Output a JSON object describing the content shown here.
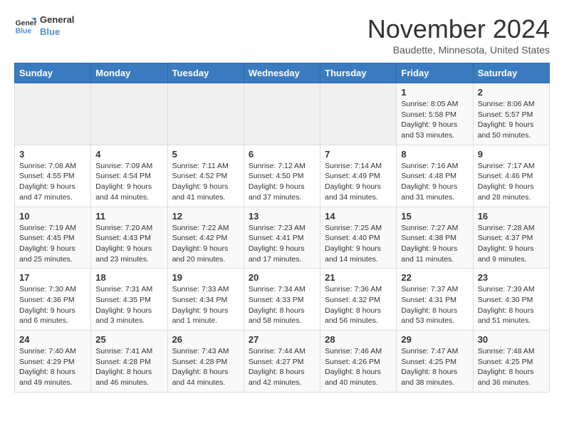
{
  "logo": {
    "line1": "General",
    "line2": "Blue"
  },
  "title": "November 2024",
  "location": "Baudette, Minnesota, United States",
  "days_of_week": [
    "Sunday",
    "Monday",
    "Tuesday",
    "Wednesday",
    "Thursday",
    "Friday",
    "Saturday"
  ],
  "weeks": [
    [
      {
        "day": "",
        "info": ""
      },
      {
        "day": "",
        "info": ""
      },
      {
        "day": "",
        "info": ""
      },
      {
        "day": "",
        "info": ""
      },
      {
        "day": "",
        "info": ""
      },
      {
        "day": "1",
        "info": "Sunrise: 8:05 AM\nSunset: 5:58 PM\nDaylight: 9 hours and 53 minutes."
      },
      {
        "day": "2",
        "info": "Sunrise: 8:06 AM\nSunset: 5:57 PM\nDaylight: 9 hours and 50 minutes."
      }
    ],
    [
      {
        "day": "3",
        "info": "Sunrise: 7:08 AM\nSunset: 4:55 PM\nDaylight: 9 hours and 47 minutes."
      },
      {
        "day": "4",
        "info": "Sunrise: 7:09 AM\nSunset: 4:54 PM\nDaylight: 9 hours and 44 minutes."
      },
      {
        "day": "5",
        "info": "Sunrise: 7:11 AM\nSunset: 4:52 PM\nDaylight: 9 hours and 41 minutes."
      },
      {
        "day": "6",
        "info": "Sunrise: 7:12 AM\nSunset: 4:50 PM\nDaylight: 9 hours and 37 minutes."
      },
      {
        "day": "7",
        "info": "Sunrise: 7:14 AM\nSunset: 4:49 PM\nDaylight: 9 hours and 34 minutes."
      },
      {
        "day": "8",
        "info": "Sunrise: 7:16 AM\nSunset: 4:48 PM\nDaylight: 9 hours and 31 minutes."
      },
      {
        "day": "9",
        "info": "Sunrise: 7:17 AM\nSunset: 4:46 PM\nDaylight: 9 hours and 28 minutes."
      }
    ],
    [
      {
        "day": "10",
        "info": "Sunrise: 7:19 AM\nSunset: 4:45 PM\nDaylight: 9 hours and 25 minutes."
      },
      {
        "day": "11",
        "info": "Sunrise: 7:20 AM\nSunset: 4:43 PM\nDaylight: 9 hours and 23 minutes."
      },
      {
        "day": "12",
        "info": "Sunrise: 7:22 AM\nSunset: 4:42 PM\nDaylight: 9 hours and 20 minutes."
      },
      {
        "day": "13",
        "info": "Sunrise: 7:23 AM\nSunset: 4:41 PM\nDaylight: 9 hours and 17 minutes."
      },
      {
        "day": "14",
        "info": "Sunrise: 7:25 AM\nSunset: 4:40 PM\nDaylight: 9 hours and 14 minutes."
      },
      {
        "day": "15",
        "info": "Sunrise: 7:27 AM\nSunset: 4:38 PM\nDaylight: 9 hours and 11 minutes."
      },
      {
        "day": "16",
        "info": "Sunrise: 7:28 AM\nSunset: 4:37 PM\nDaylight: 9 hours and 9 minutes."
      }
    ],
    [
      {
        "day": "17",
        "info": "Sunrise: 7:30 AM\nSunset: 4:36 PM\nDaylight: 9 hours and 6 minutes."
      },
      {
        "day": "18",
        "info": "Sunrise: 7:31 AM\nSunset: 4:35 PM\nDaylight: 9 hours and 3 minutes."
      },
      {
        "day": "19",
        "info": "Sunrise: 7:33 AM\nSunset: 4:34 PM\nDaylight: 9 hours and 1 minute."
      },
      {
        "day": "20",
        "info": "Sunrise: 7:34 AM\nSunset: 4:33 PM\nDaylight: 8 hours and 58 minutes."
      },
      {
        "day": "21",
        "info": "Sunrise: 7:36 AM\nSunset: 4:32 PM\nDaylight: 8 hours and 56 minutes."
      },
      {
        "day": "22",
        "info": "Sunrise: 7:37 AM\nSunset: 4:31 PM\nDaylight: 8 hours and 53 minutes."
      },
      {
        "day": "23",
        "info": "Sunrise: 7:39 AM\nSunset: 4:30 PM\nDaylight: 8 hours and 51 minutes."
      }
    ],
    [
      {
        "day": "24",
        "info": "Sunrise: 7:40 AM\nSunset: 4:29 PM\nDaylight: 8 hours and 49 minutes."
      },
      {
        "day": "25",
        "info": "Sunrise: 7:41 AM\nSunset: 4:28 PM\nDaylight: 8 hours and 46 minutes."
      },
      {
        "day": "26",
        "info": "Sunrise: 7:43 AM\nSunset: 4:28 PM\nDaylight: 8 hours and 44 minutes."
      },
      {
        "day": "27",
        "info": "Sunrise: 7:44 AM\nSunset: 4:27 PM\nDaylight: 8 hours and 42 minutes."
      },
      {
        "day": "28",
        "info": "Sunrise: 7:46 AM\nSunset: 4:26 PM\nDaylight: 8 hours and 40 minutes."
      },
      {
        "day": "29",
        "info": "Sunrise: 7:47 AM\nSunset: 4:25 PM\nDaylight: 8 hours and 38 minutes."
      },
      {
        "day": "30",
        "info": "Sunrise: 7:48 AM\nSunset: 4:25 PM\nDaylight: 8 hours and 36 minutes."
      }
    ]
  ]
}
